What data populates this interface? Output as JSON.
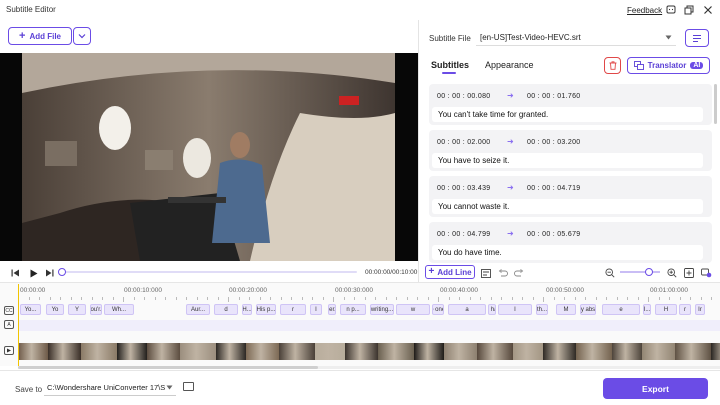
{
  "titlebar": {
    "title": "Subtitle Editor",
    "feedback": "Feedback"
  },
  "toolbar": {
    "add_file": "Add File"
  },
  "subtitle_file": {
    "label": "Subtitle File",
    "value": "[en-US]Test-Video-HEVC.srt"
  },
  "tabs": [
    {
      "label": "Subtitles",
      "active": true
    },
    {
      "label": "Appearance",
      "active": false
    }
  ],
  "translator": {
    "label": "Translator",
    "badge": "AI"
  },
  "subtitles": [
    {
      "start": "00 : 00 : 00.080",
      "end": "00 : 00 : 01.760",
      "text": "You can't take time for granted."
    },
    {
      "start": "00 : 00 : 02.000",
      "end": "00 : 00 : 03.200",
      "text": "You have to seize it."
    },
    {
      "start": "00 : 00 : 03.439",
      "end": "00 : 00 : 04.719",
      "text": "You cannot waste it."
    },
    {
      "start": "00 : 00 : 04.799",
      "end": "00 : 00 : 05.679",
      "text": "You do have time."
    }
  ],
  "player": {
    "time": "00:00:00/00:10:00",
    "progress": 0.0
  },
  "timeline": {
    "add_line": "Add Line",
    "ruler": [
      "00:00:00",
      "00:00:10:000",
      "00:00:20:000",
      "00:00:30:000",
      "00:00:40:000",
      "00:00:50:000",
      "00:01:00:000"
    ],
    "chips": [
      "Yo...",
      "Yo",
      "Y",
      "You'r...",
      "Wh...",
      "Aur...",
      "d",
      "H...",
      "His p...",
      "r",
      "I",
      "Ner...",
      "n p...",
      "writing...",
      "w",
      "No one...",
      "a",
      "He ha...",
      "I",
      "th...",
      "M",
      "my abs...",
      "e",
      "I...",
      "H",
      "r",
      "Ir"
    ]
  },
  "footer": {
    "save_label": "Save to",
    "save_path": "C:\\Wondershare UniConverter 17\\S",
    "export": "Export"
  },
  "colors": {
    "accent": "#6b4ce6",
    "danger": "#e04848",
    "playhead": "#f2c500"
  }
}
